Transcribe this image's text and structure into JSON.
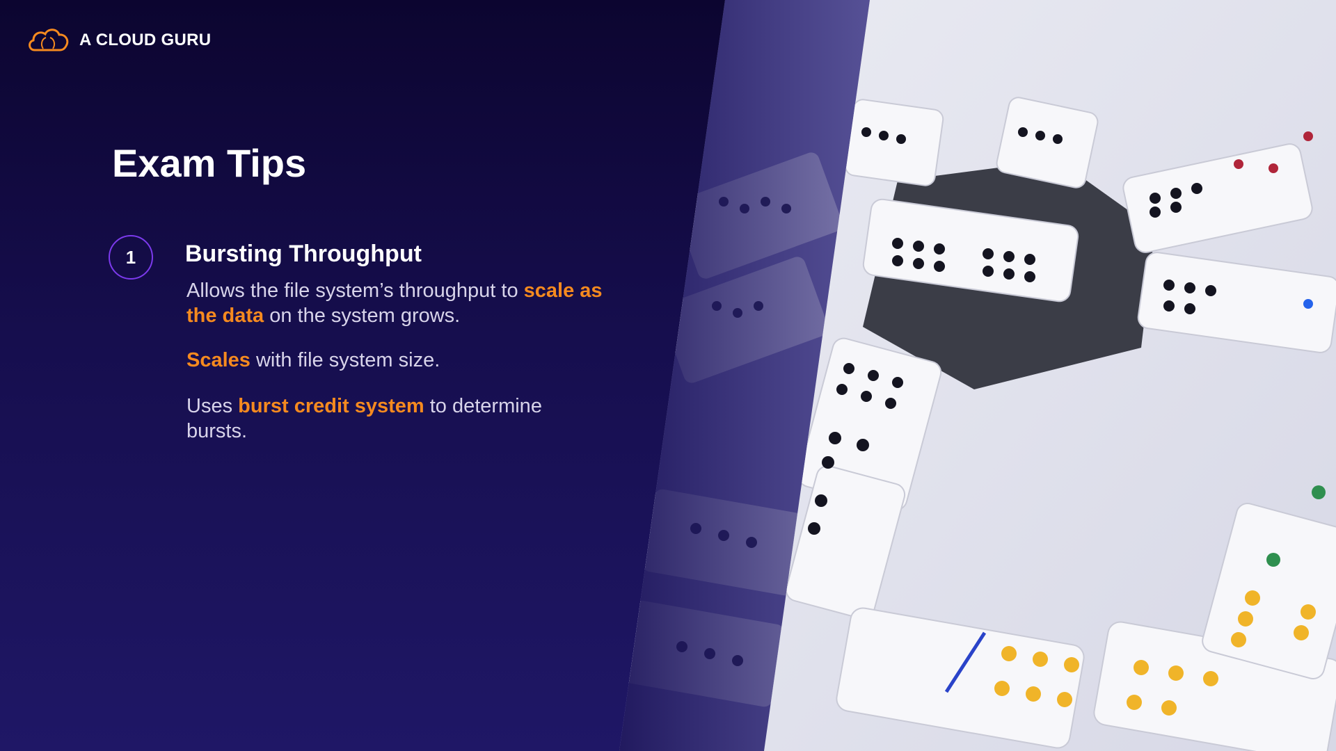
{
  "brand": {
    "name": "A CLOUD GURU",
    "logo_icon": "cloud-logo-icon",
    "accent": "#f58a1f"
  },
  "slide": {
    "title": "Exam Tips",
    "tip": {
      "number": "1",
      "title": "Bursting Throughput",
      "paragraphs": [
        {
          "parts": [
            "Allows the file system’s throughput to ",
            "scale as the data",
            " on the system grows."
          ]
        },
        {
          "parts": [
            "Scales",
            " with file system size."
          ]
        },
        {
          "parts": [
            "Uses ",
            "burst credit system",
            " to determine bursts."
          ]
        }
      ]
    }
  },
  "colors": {
    "background": "#0f0839",
    "highlight": "#f58a1f",
    "circle_border": "#7c3aed",
    "body_text": "#d8d4ea"
  },
  "image": {
    "subject": "dominoes on a table"
  }
}
